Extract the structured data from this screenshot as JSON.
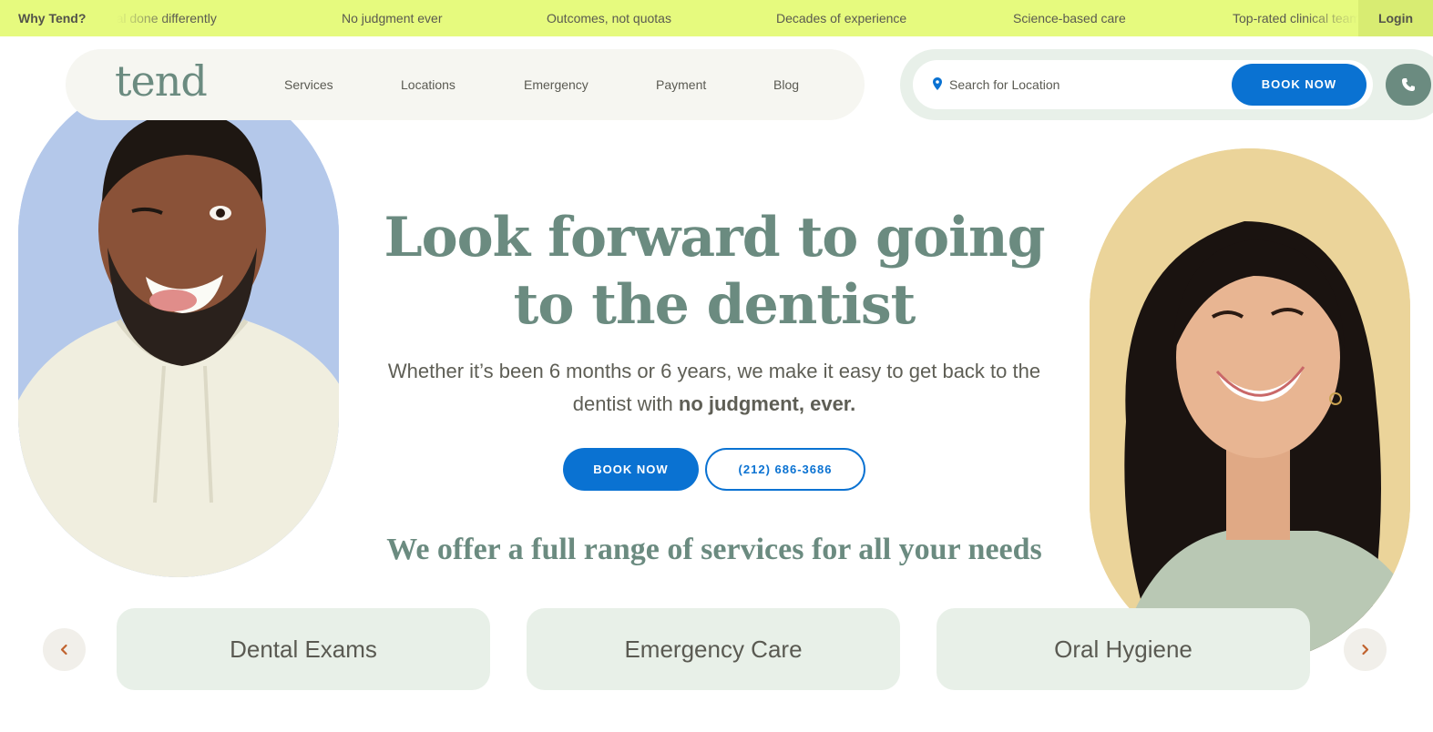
{
  "ticker": {
    "why_label": "Why Tend?",
    "items": [
      "Dental done differently",
      "No judgment ever",
      "Outcomes, not quotas",
      "Decades of experience",
      "Science-based care",
      "Top-rated clinical team"
    ],
    "login_label": "Login",
    "bg_color": "#e6fa7e"
  },
  "nav": {
    "logo": "tend",
    "links": [
      "Services",
      "Locations",
      "Emergency",
      "Payment",
      "Blog"
    ]
  },
  "search": {
    "placeholder": "Search for Location",
    "book_label": "BOOK NOW",
    "phone_icon": "phone-icon",
    "pin_icon": "location-pin-icon"
  },
  "hero": {
    "title": "Look forward to going to the dentist",
    "subtitle_plain": "Whether it’s been 6 months or 6 years, we make it easy to get back to the dentist with ",
    "subtitle_bold": "no judgment, ever.",
    "book_label": "BOOK NOW",
    "phone_label": "(212) 686-3686"
  },
  "services": {
    "heading_plain": "We offer a full range of services for ",
    "heading_bold": "all your needs",
    "cards": [
      "Dental Exams",
      "Emergency Care",
      "Oral Hygiene"
    ],
    "prev_icon": "chevron-left-icon",
    "next_icon": "chevron-right-icon"
  },
  "colors": {
    "brand_green": "#6b8b80",
    "primary_blue": "#0a72d2",
    "card_bg": "#e8f0e8",
    "left_photo_bg": "#b4c8ea",
    "right_photo_bg": "#ebd49a"
  }
}
